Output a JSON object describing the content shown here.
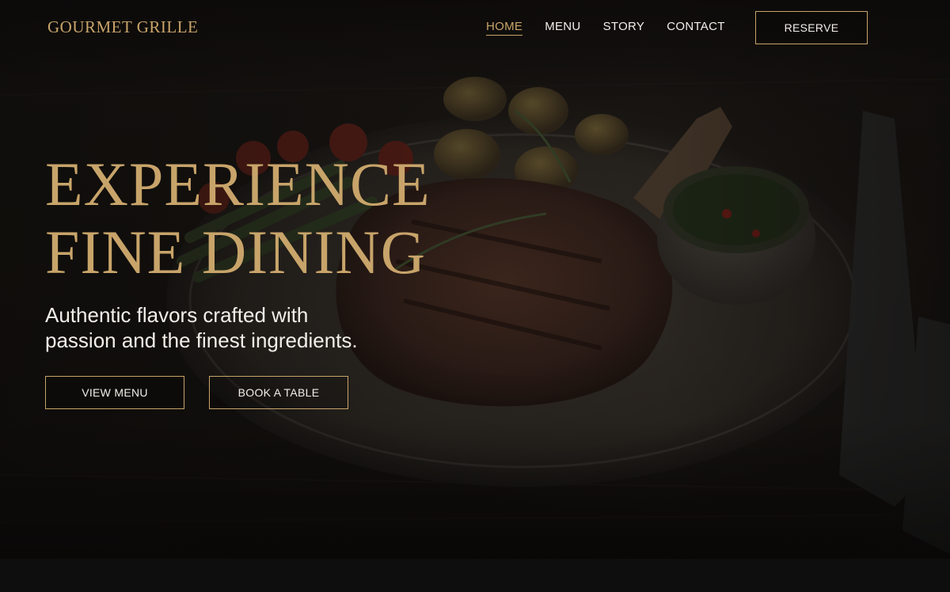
{
  "brand": {
    "logo_text": "GOURMET GRILLE",
    "accent_color": "#c8a46a"
  },
  "nav": {
    "items": [
      {
        "label": "HOME",
        "active": true
      },
      {
        "label": "MENU",
        "active": false
      },
      {
        "label": "STORY",
        "active": false
      },
      {
        "label": "CONTACT",
        "active": false
      }
    ],
    "reserve_label": "RESERVE"
  },
  "hero": {
    "headline_line1": "EXPERIENCE",
    "headline_line2": "FINE DINING",
    "subtitle_line1": "Authentic flavors crafted with",
    "subtitle_line2": "passion and the finest ingredients.",
    "view_menu_label": "VIEW MENU",
    "book_table_label": "BOOK A TABLE",
    "background": "steak-dinner-plate-photo"
  }
}
